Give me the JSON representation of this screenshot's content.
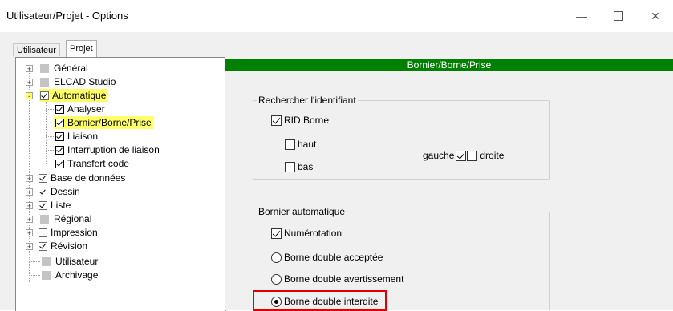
{
  "window": {
    "title": "Utilisateur/Projet - Options",
    "min_icon": "minimize-icon",
    "max_icon": "maximize-icon",
    "close_icon": "close-icon"
  },
  "tabs": [
    {
      "label": "Utilisateur",
      "selected": false
    },
    {
      "label": "Projet",
      "selected": true
    }
  ],
  "tree": {
    "items": [
      {
        "label": "Général",
        "expander": "+",
        "marker": "gray"
      },
      {
        "label": "ELCAD Studio",
        "expander": "+",
        "marker": "gray"
      },
      {
        "label": "Automatique",
        "expander": "-",
        "marker": "checked",
        "highlight": true
      },
      {
        "label": "Analyser",
        "marker": "checked-bold"
      },
      {
        "label": "Bornier/Borne/Prise",
        "marker": "checked-bold",
        "highlight": true
      },
      {
        "label": "Liaison",
        "marker": "checked-bold"
      },
      {
        "label": "Interruption de liaison",
        "marker": "checked-bold"
      },
      {
        "label": "Transfert code",
        "marker": "checked-bold"
      },
      {
        "label": "Base de données",
        "expander": "+",
        "marker": "checked"
      },
      {
        "label": "Dessin",
        "expander": "+",
        "marker": "checked"
      },
      {
        "label": "Liste",
        "expander": "+",
        "marker": "checked"
      },
      {
        "label": "Régional",
        "expander": "+",
        "marker": "gray"
      },
      {
        "label": "Impression",
        "expander": "+",
        "marker": "unchecked"
      },
      {
        "label": "Révision",
        "expander": "+",
        "marker": "checked"
      },
      {
        "label": "Utilisateur",
        "marker": "gray"
      },
      {
        "label": "Archivage",
        "marker": "gray"
      }
    ]
  },
  "panel": {
    "header": "Bornier/Borne/Prise",
    "header_color": "#008000",
    "group1": {
      "title": "Rechercher l'identifiant",
      "rid_borne": {
        "label": "RID Borne",
        "checked": true
      },
      "haut": {
        "label": "haut",
        "checked": false
      },
      "bas": {
        "label": "bas",
        "checked": false
      },
      "gauche": {
        "label": "gauche",
        "checked": true
      },
      "droite": {
        "label": "droite",
        "checked": false
      }
    },
    "group2": {
      "title": "Bornier automatique",
      "numerotation": {
        "label": "Numérotation",
        "checked": true
      },
      "radios": [
        {
          "label": "Borne double acceptée",
          "selected": false
        },
        {
          "label": "Borne double avertissement",
          "selected": false
        },
        {
          "label": "Borne double interdite",
          "selected": true
        }
      ]
    },
    "highlight_color": "#e00000"
  }
}
